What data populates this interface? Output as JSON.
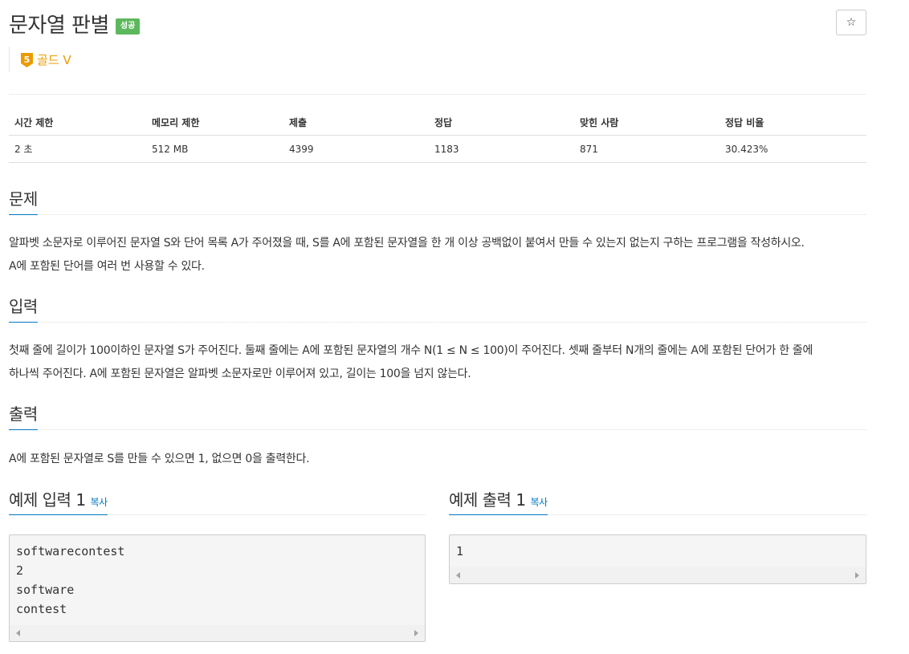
{
  "problem": {
    "title": "문자열 판별",
    "badge": "성공",
    "star_icon": "☆",
    "tier_number": "5",
    "tier_label": "골드 V"
  },
  "stats": {
    "headers": [
      "시간 제한",
      "메모리 제한",
      "제출",
      "정답",
      "맞힌 사람",
      "정답 비율"
    ],
    "values": [
      "2 초",
      "512 MB",
      "4399",
      "1183",
      "871",
      "30.423%"
    ]
  },
  "sections": {
    "problem_heading": "문제",
    "problem_line1": "알파벳 소문자로 이루어진 문자열 S와 단어 목록 A가 주어졌을 때, S를 A에 포함된 문자열을 한 개 이상 공백없이 붙여서 만들 수 있는지 없는지 구하는 프로그램을 작성하시오.",
    "problem_line2": "A에 포함된 단어를 여러 번 사용할 수 있다.",
    "input_heading": "입력",
    "input_line1": "첫째 줄에 길이가 100이하인 문자열 S가 주어진다. 둘째 줄에는 A에 포함된 문자열의 개수 N(1 ≤ N ≤ 100)이 주어진다. 셋째 줄부터 N개의 줄에는 A에 포함된 단어가 한 줄에",
    "input_line2": "하나씩 주어진다. A에 포함된 문자열은 알파벳 소문자로만 이루어져 있고, 길이는 100을 넘지 않는다.",
    "output_heading": "출력",
    "output_line1": "A에 포함된 문자열로 S를 만들 수 있으면 1, 없으면 0을 출력한다."
  },
  "examples": {
    "input_heading": "예제 입력 1",
    "output_heading": "예제 출력 1",
    "copy_label": "복사",
    "input_text": "softwarecontest\n2\nsoftware\ncontest",
    "output_text": "1"
  },
  "colors": {
    "badge_bg": "#5cb85c",
    "tier_gold": "#ec9a00",
    "link_blue": "#0076c0"
  }
}
